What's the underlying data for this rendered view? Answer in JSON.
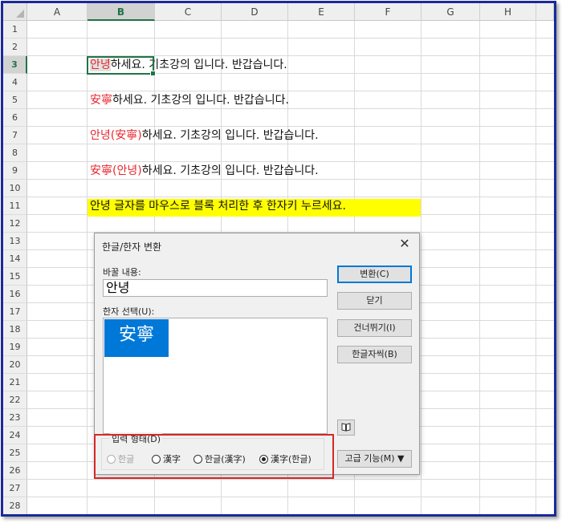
{
  "columns": [
    "A",
    "B",
    "C",
    "D",
    "E",
    "F",
    "G",
    "H"
  ],
  "rows": [
    "1",
    "2",
    "3",
    "4",
    "5",
    "6",
    "7",
    "8",
    "9",
    "10",
    "11",
    "12",
    "13",
    "14",
    "15",
    "16",
    "17",
    "18",
    "19",
    "20",
    "21",
    "22",
    "23",
    "24",
    "25",
    "26",
    "27",
    "28"
  ],
  "cells": {
    "r3_red": "안녕",
    "r3_rest": "하세요. 기초강의 입니다. 반갑습니다.",
    "r5_red": "安寧",
    "r5_rest": "하세요. 기초강의 입니다. 반갑습니다.",
    "r7_red": "안녕(安寧)",
    "r7_rest": "하세요. 기초강의 입니다. 반갑습니다.",
    "r9_red": "安寧(안녕)",
    "r9_rest": "하세요. 기초강의 입니다. 반갑습니다.",
    "r11": "안녕 글자를 마우스로 블록 처리한 후 한자키 누르세요."
  },
  "dialog": {
    "title": "한글/한자 변환",
    "close": "✕",
    "replace_label": "바꿀 내용:",
    "replace_value": "안녕",
    "hanja_label": "한자 선택(U):",
    "hanja_item": "安寧",
    "buttons": {
      "convert": "변환(C)",
      "close": "닫기",
      "skip": "건너뛰기(I)",
      "dictionary": "한글자씩(B)",
      "advanced": "고급 기능(M) ▼"
    },
    "input_form": {
      "legend": "입력 형태(D)",
      "options": [
        "한글",
        "漢字",
        "한글(漢字)",
        "漢字(한글)"
      ],
      "selected": "漢字(한글)"
    }
  },
  "colors": {
    "accent_green": "#217346",
    "red_text": "#e8262b",
    "highlight_yellow": "#ffff00",
    "selection_blue": "#0078d7",
    "frame_blue": "#1a2a9a",
    "annotation_red": "#d62828"
  }
}
